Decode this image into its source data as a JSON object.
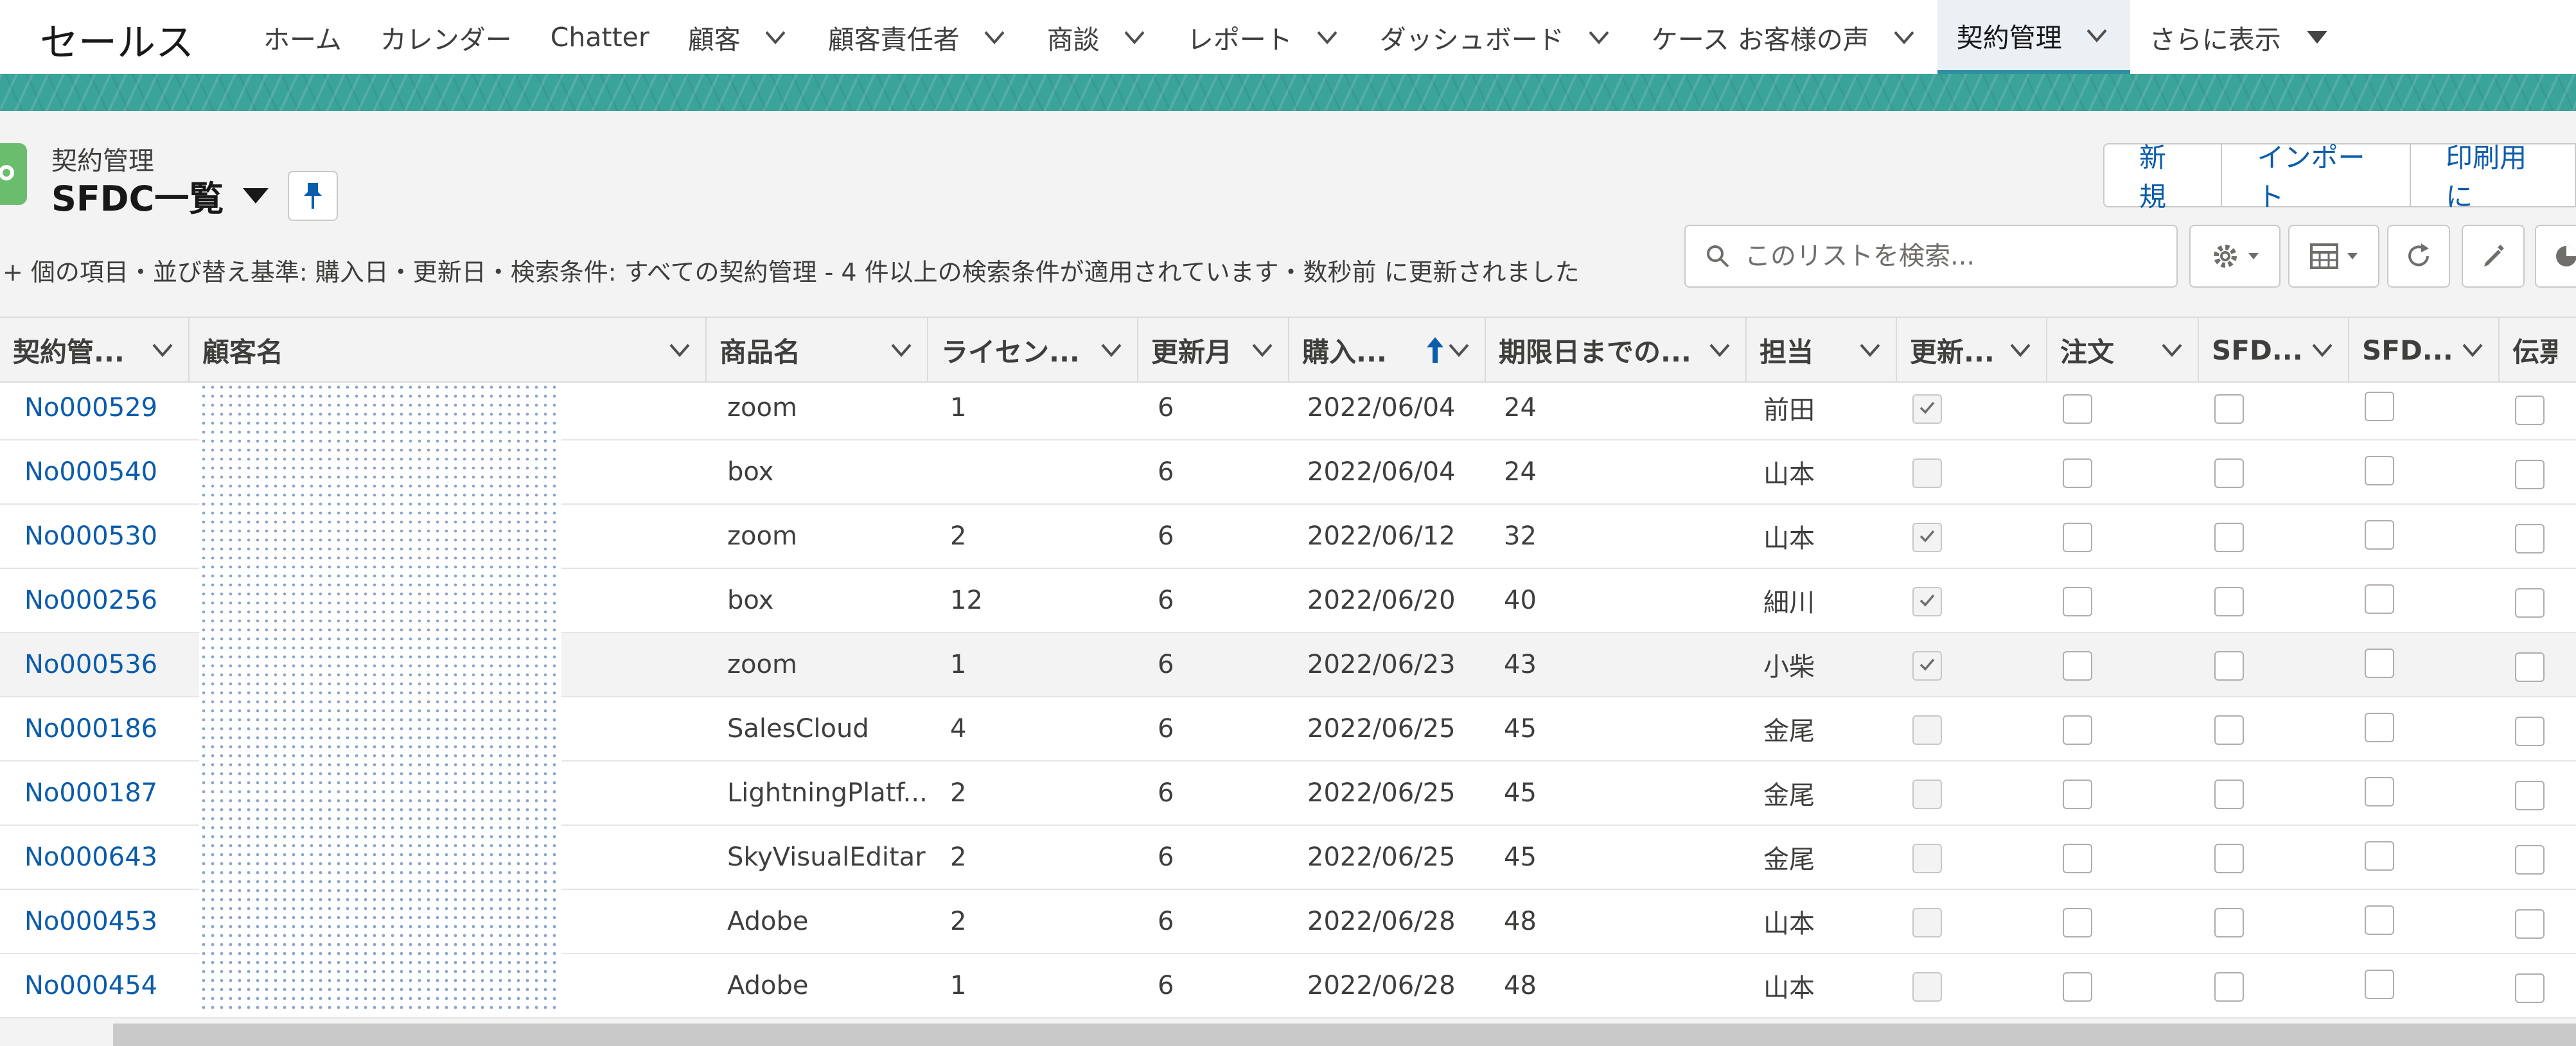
{
  "app_name": "セールス",
  "nav": [
    {
      "label": "ホーム",
      "dropdown": false,
      "active": false
    },
    {
      "label": "カレンダー",
      "dropdown": false,
      "active": false
    },
    {
      "label": "Chatter",
      "dropdown": false,
      "active": false
    },
    {
      "label": "顧客",
      "dropdown": true,
      "active": false
    },
    {
      "label": "顧客責任者",
      "dropdown": true,
      "active": false
    },
    {
      "label": "商談",
      "dropdown": true,
      "active": false
    },
    {
      "label": "レポート",
      "dropdown": true,
      "active": false
    },
    {
      "label": "ダッシュボード",
      "dropdown": true,
      "active": false
    },
    {
      "label": "ケース お客様の声",
      "dropdown": true,
      "active": false
    },
    {
      "label": "契約管理",
      "dropdown": true,
      "active": true
    }
  ],
  "nav_more": "さらに表示",
  "header": {
    "object_label": "契約管理",
    "list_view_name": "SFDC一覧",
    "buttons": [
      "新規",
      "インポート",
      "印刷用に"
    ],
    "info_text": "+ 個の項目・並び替え基準: 購入日・更新日・検索条件: すべての契約管理 - 4 件以上の検索条件が適用されています・数秒前 に更新されました",
    "search_placeholder": "このリストを検索..."
  },
  "columns": [
    "契約管...",
    "顧客名",
    "商品名",
    "ライセン...",
    "更新月",
    "購入...",
    "期限日までの...",
    "担当",
    "更新...",
    "注文",
    "SFD...",
    "SFD...",
    "伝票"
  ],
  "sorted_column": "購入...",
  "rows": [
    {
      "id": "No000529",
      "product": "zoom",
      "license": "1",
      "month": "6",
      "date": "2022/06/04",
      "days": "24",
      "owner": "前田",
      "renewed": true
    },
    {
      "id": "No000540",
      "product": "box",
      "license": "",
      "month": "6",
      "date": "2022/06/04",
      "days": "24",
      "owner": "山本",
      "renewed": false
    },
    {
      "id": "No000530",
      "product": "zoom",
      "license": "2",
      "month": "6",
      "date": "2022/06/12",
      "days": "32",
      "owner": "山本",
      "renewed": true
    },
    {
      "id": "No000256",
      "product": "box",
      "license": "12",
      "month": "6",
      "date": "2022/06/20",
      "days": "40",
      "owner": "細川",
      "renewed": true
    },
    {
      "id": "No000536",
      "product": "zoom",
      "license": "1",
      "month": "6",
      "date": "2022/06/23",
      "days": "43",
      "owner": "小柴",
      "renewed": true
    },
    {
      "id": "No000186",
      "product": "SalesCloud",
      "license": "4",
      "month": "6",
      "date": "2022/06/25",
      "days": "45",
      "owner": "金尾",
      "renewed": false
    },
    {
      "id": "No000187",
      "product": "LightningPlatf...",
      "license": "2",
      "month": "6",
      "date": "2022/06/25",
      "days": "45",
      "owner": "金尾",
      "renewed": false
    },
    {
      "id": "No000643",
      "product": "SkyVisualEditar",
      "license": "2",
      "month": "6",
      "date": "2022/06/25",
      "days": "45",
      "owner": "金尾",
      "renewed": false
    },
    {
      "id": "No000453",
      "product": "Adobe",
      "license": "2",
      "month": "6",
      "date": "2022/06/28",
      "days": "48",
      "owner": "山本",
      "renewed": false
    },
    {
      "id": "No000454",
      "product": "Adobe",
      "license": "1",
      "month": "6",
      "date": "2022/06/28",
      "days": "48",
      "owner": "山本",
      "renewed": false
    }
  ],
  "colors": {
    "link": "#0b5cab",
    "brand_band": "#3aa39a",
    "object_icon": "#6bbd6e"
  }
}
